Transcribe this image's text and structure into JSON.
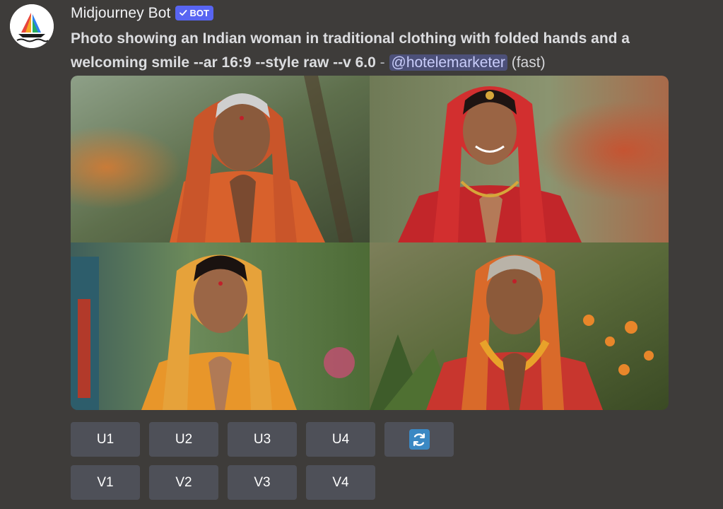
{
  "message": {
    "author": "Midjourney Bot",
    "badge": "BOT",
    "prompt_text": "Photo showing an Indian woman in traditional clothing with folded hands and a welcoming smile --ar 16:9 --style raw --v 6.0",
    "separator": " - ",
    "mention": "@hotelemarketer",
    "mode": "(fast)"
  },
  "images": [
    {
      "name": "elderly-woman-orange-sari"
    },
    {
      "name": "young-woman-red-dupatta"
    },
    {
      "name": "young-woman-yellow-sari"
    },
    {
      "name": "elderly-woman-marigold-garland"
    }
  ],
  "buttons": {
    "upscale": [
      "U1",
      "U2",
      "U3",
      "U4"
    ],
    "variation": [
      "V1",
      "V2",
      "V3",
      "V4"
    ],
    "reroll_icon": "reroll-icon"
  },
  "colors": {
    "background": "#3e3c3a",
    "bot_badge": "#5865f2",
    "button": "#4e5058",
    "mention_bg": "#4c5079",
    "reroll": "#3b88c3"
  }
}
